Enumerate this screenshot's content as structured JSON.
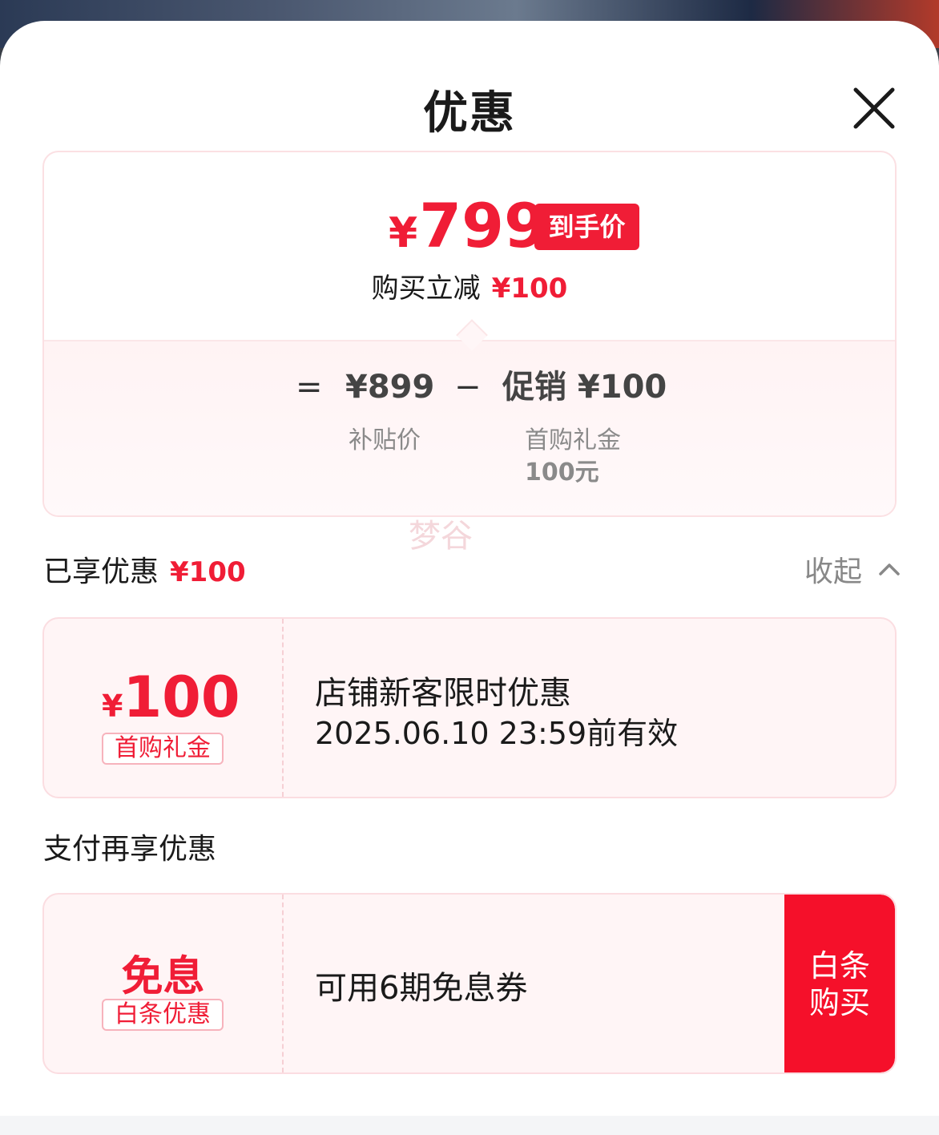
{
  "sheet": {
    "title": "优惠"
  },
  "summary": {
    "final_price": "799",
    "currency": "¥",
    "final_tag": "到手价",
    "reduce_label": "购买立减",
    "reduce_amount": "¥100",
    "formula": {
      "equals": "=",
      "base_price": "¥899",
      "base_label": "补贴价",
      "minus": "−",
      "promo_label": "促销 ¥100",
      "promo_sub": "首购礼金",
      "promo_sub2": "100元"
    }
  },
  "watermark": "梦谷",
  "enjoyed": {
    "title": "已享优惠",
    "amount": "¥100",
    "collapse_label": "收起"
  },
  "coupon1": {
    "currency": "¥",
    "value": "100",
    "badge": "首购礼金",
    "title": "店铺新客限时优惠",
    "validity": "2025.06.10 23:59前有效"
  },
  "pay_section": {
    "title": "支付再享优惠"
  },
  "coupon2": {
    "value": "免息",
    "badge": "白条优惠",
    "title": "可用6期免息券",
    "button_line1": "白条",
    "button_line2": "购买"
  },
  "colors": {
    "accent": "#f01d36",
    "button": "#f5102a",
    "card_bg": "#fff5f6"
  }
}
